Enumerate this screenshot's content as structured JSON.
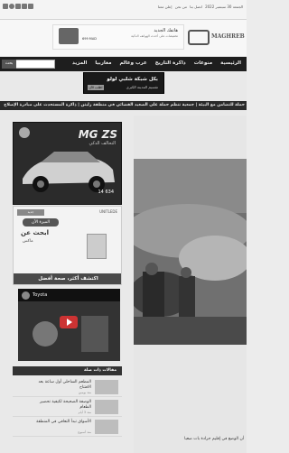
{
  "topbar": {
    "links": [
      "الجمعة 30 سبتمبر 2022",
      "اتصل بنا",
      "من نحن",
      "إعلن معنا"
    ],
    "social_icons": [
      "instagram-icon",
      "rss-icon",
      "youtube-icon",
      "twitter-icon",
      "facebook-icon"
    ]
  },
  "header": {
    "ad_title": "هاتفك الجديد",
    "ad_text": "تخفيضات على أحدث الهواتف الذكية",
    "ad_price": "699 MAD",
    "logo_text": "MAGHREB"
  },
  "nav": {
    "items": [
      "الرئيسية",
      "منوعات",
      "ذاكرة التاريخ",
      "عرب وعالم",
      "مغاربيا",
      "المزيد"
    ],
    "search_button": "بحث",
    "search_placeholder": ""
  },
  "promo": {
    "line1": "بكل شبكة شلبي لولو",
    "line2": "تقسيم المدينة الكبرى",
    "button": "اطلب الآن"
  },
  "ticker": {
    "text": "حملة للتضامن مع البيئة | جمعية تنظم حملة على الصعيد القضائي في منطقة زليتن | ذاكرة المستحدث على مبادرة الإصلاح"
  },
  "sidebar": {
    "ad1": {
      "title": "MG ZS",
      "subtitle": "التحالف الذكي",
      "price": "14 634"
    },
    "ad2": {
      "top": "UNITLEDE",
      "brand": "جديد",
      "pill": "الميزة الآن",
      "big": "ابحث عن",
      "line": "ماكس",
      "bottom": "اكتشف أكثر، صحة أفضل"
    },
    "video": {
      "title": "Toyota"
    },
    "widget_title": "مقالات ذات صلة",
    "widget_items": [
      {
        "title": "المطعم الساحلي أول ساعة بعد الافتتاح",
        "date": "منذ يومين"
      },
      {
        "title": "الوصفة الصحيحة لكيفية تحضير الطعام",
        "date": "منذ 3 أيام"
      },
      {
        "title": "الأسواق تبدأ التعافي في المنطقة",
        "date": "منذ أسبوع"
      }
    ]
  },
  "main": {
    "caption": "أن الوضع في إقليم جرادة بات صعبا"
  }
}
